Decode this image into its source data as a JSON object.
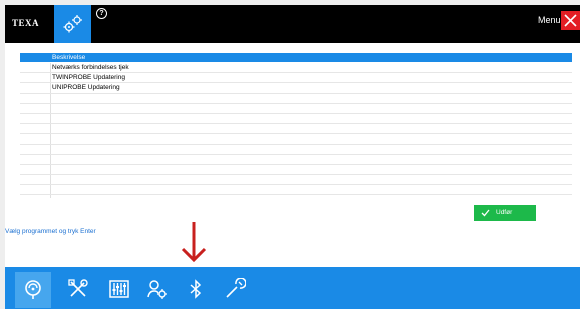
{
  "topbar": {
    "logo": "TEXA",
    "help_symbol": "?",
    "menu_label": "Menu",
    "settings_icon": "gears-icon",
    "close_icon": "close-icon"
  },
  "table": {
    "header": "Beskrivelse",
    "rows": [
      "Netværks forbindelses tjek",
      "TWINPROBE Updatering",
      "UNIPROBE Updatering",
      "",
      "",
      "",
      "",
      "",
      "",
      "",
      "",
      "",
      ""
    ]
  },
  "exit_button": {
    "label": "Udfør",
    "icon": "check-icon"
  },
  "hint": "Vælg programmet og tryk Enter",
  "bottom_nav": {
    "items": [
      {
        "icon": "diagnosis-icon",
        "active": true
      },
      {
        "icon": "tools-icon",
        "active": false
      },
      {
        "icon": "equalizer-icon",
        "active": false
      },
      {
        "icon": "user-settings-icon",
        "active": false
      },
      {
        "icon": "bluetooth-icon",
        "active": false
      },
      {
        "icon": "wrench-icon",
        "active": false
      }
    ]
  },
  "colors": {
    "accent": "#1a8ae6",
    "close": "#e31e24",
    "exit": "#1db94a",
    "hint": "#1a6fd1",
    "arrow": "#c8201e"
  }
}
